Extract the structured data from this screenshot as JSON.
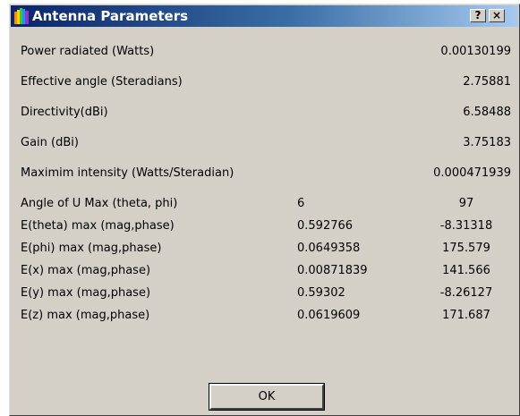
{
  "window": {
    "title": "Antenna Parameters",
    "help_label": "?",
    "close_label": "×",
    "colors": {
      "face": "#d4d0c8",
      "title_start": "#0a246a",
      "title_end": "#a6caf0"
    }
  },
  "summary": [
    {
      "label": "Power radiated (Watts)",
      "value": "0.00130199"
    },
    {
      "label": "Effective angle (Steradians)",
      "value": "2.75881"
    },
    {
      "label": "Directivity(dBi)",
      "value": "6.58488"
    },
    {
      "label": "Gain (dBi)",
      "value": "3.75183"
    },
    {
      "label": "Maximim intensity (Watts/Steradian)",
      "value": "0.000471939"
    }
  ],
  "details": [
    {
      "label": "Angle of U Max (theta, phi)",
      "mag": "6",
      "phase": "97"
    },
    {
      "label": "E(theta) max (mag,phase)",
      "mag": "0.592766",
      "phase": "-8.31318"
    },
    {
      "label": "E(phi) max (mag,phase)",
      "mag": "0.0649358",
      "phase": "175.579"
    },
    {
      "label": "E(x) max (mag,phase)",
      "mag": "0.00871839",
      "phase": "141.566"
    },
    {
      "label": "E(y) max (mag,phase)",
      "mag": "0.59302",
      "phase": "-8.26127"
    },
    {
      "label": "E(z) max (mag,phase)",
      "mag": "0.0619609",
      "phase": "171.687"
    }
  ],
  "ok_label": "OK"
}
